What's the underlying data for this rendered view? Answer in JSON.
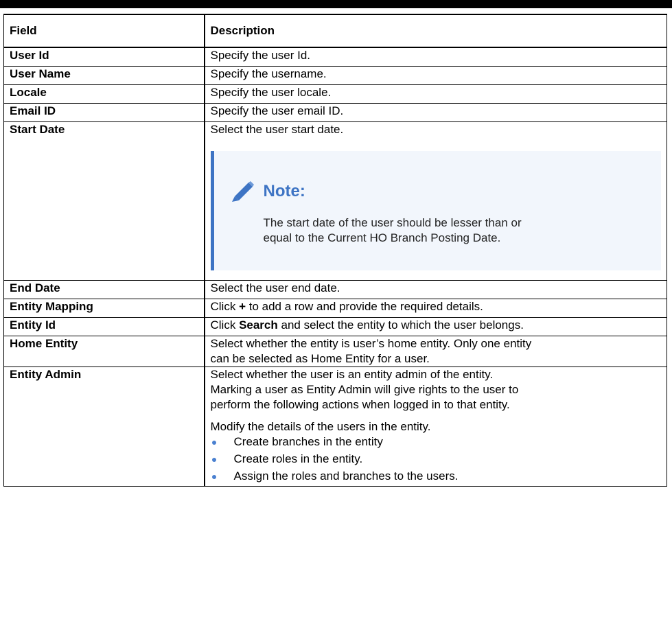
{
  "table": {
    "headers": {
      "field": "Field",
      "description": "Description"
    },
    "rows": [
      {
        "field": "User Id",
        "description": "Specify the user Id."
      },
      {
        "field": "User Name",
        "description": "Specify the username."
      },
      {
        "field": "Locale",
        "description": "Specify the user locale."
      },
      {
        "field": "Email ID",
        "description": "Specify the user email ID."
      },
      {
        "field": "Start Date",
        "description": "Select the user start date.",
        "note": {
          "title": "Note:",
          "icon": "pencil-icon",
          "text_line1": "The start date of the user should be lesser than or",
          "text_line2": "equal to the Current HO Branch Posting Date."
        }
      },
      {
        "field": "End Date",
        "description": "Select the user end date."
      },
      {
        "field": "Entity Mapping",
        "description_pre": "Click ",
        "description_bold": "+",
        "description_post": " to add a row and provide the required details."
      },
      {
        "field": "Entity Id",
        "description_pre": "Click ",
        "description_bold": "Search",
        "description_post": " and select the entity to which the user belongs."
      },
      {
        "field": "Home Entity",
        "description_line1": "Select whether the entity is user’s home entity. Only one entity",
        "description_line2": "can be selected as Home Entity for a user."
      },
      {
        "field": "Entity Admin",
        "description_line1": "Select whether the user is an entity admin of the entity.",
        "description_line2": "Marking a user as Entity Admin will give rights to the user to",
        "description_line3": "perform the following actions when logged in to that entity.",
        "description_para2": "Modify the details of the users in the entity.",
        "bullets": [
          "Create branches in the entity",
          "Create roles in the entity.",
          "Assign the roles and branches to the users."
        ]
      }
    ]
  },
  "colors": {
    "note_accent": "#3e74c4",
    "note_background": "#f2f6fc",
    "bullet": "#4a80d0",
    "rule": "#000000"
  }
}
